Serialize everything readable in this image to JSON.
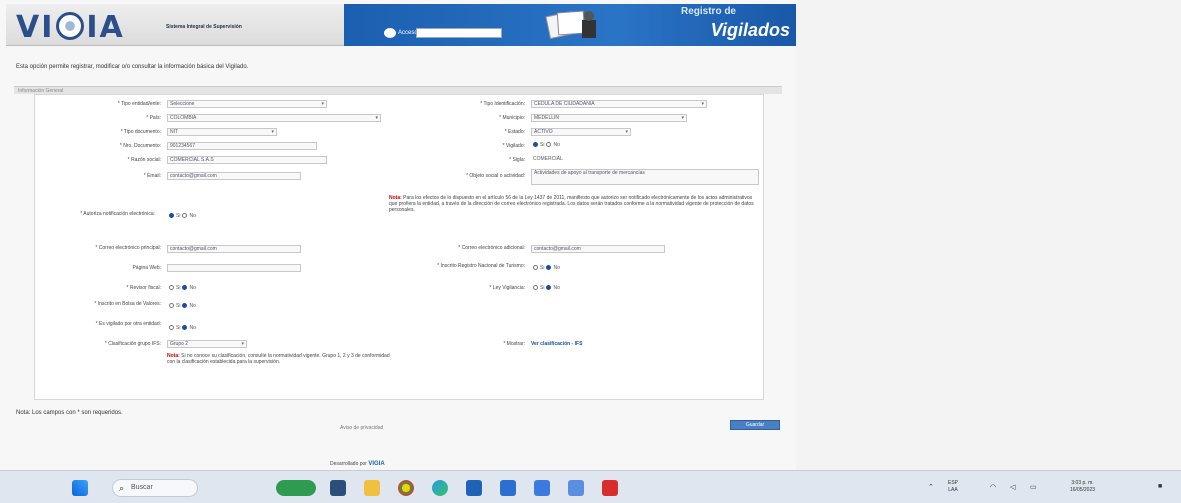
{
  "header": {
    "logo": "VIGIA",
    "logo_subtitle": "Sistema Integral de Supervisión",
    "access_label": "Acceso",
    "title_line1": "Registro de",
    "title_line2": "Vigilados"
  },
  "instruction": "Esta opción permite registrar, modificar o/o consultar la información básica del Vigilado.",
  "section_title": "Información General",
  "form": {
    "fields": [
      {
        "label": "* Tipo entidad/ente:",
        "value": "Seleccione"
      },
      {
        "label": "* Tipo Identificación:",
        "value": "CEDULA DE CIUDADANIA"
      },
      {
        "label": "* País:",
        "value": "COLOMBIA"
      },
      {
        "label": "* Municipio:",
        "value": "MEDELLIN"
      },
      {
        "label": "* Tipo documento:",
        "value": "NIT"
      },
      {
        "label": "* Estado:",
        "value": "ACTIVO"
      },
      {
        "label": "* Nro. Documento:",
        "value": "901234567"
      },
      {
        "label": "* Vigilado:",
        "value": ""
      },
      {
        "label": "* Razón social:",
        "value": "COMERCIAL S.A.S"
      },
      {
        "label": "* Sigla:",
        "value": "COMERCIAL"
      },
      {
        "label": "* Email:",
        "value": "contacto@gmail.com"
      },
      {
        "label": "* Objeto social o actividad:",
        "value": "Actividades de apoyo al transporte de mercancías"
      },
      {
        "label": "* Autoriza notificación electrónica:",
        "value": ""
      },
      {
        "label": "* Correo electrónico principal:",
        "value": "contacto@gmail.com"
      },
      {
        "label": "* Correo electrónico adicional:",
        "value": "contacto@gmail.com"
      },
      {
        "label": "Página Web:",
        "value": ""
      },
      {
        "label": "* Inscrito Registro Nacional de Turismo:",
        "value": ""
      },
      {
        "label": "* Revisor fiscal:",
        "value": ""
      },
      {
        "label": "* Ley Vigilancia:",
        "value": ""
      },
      {
        "label": "* Inscrito en Bolsa de Valores:",
        "value": ""
      },
      {
        "label": "* Es vigilado por otra entidad:",
        "value": ""
      },
      {
        "label": "* Clasificación grupo IFS:",
        "value": "Grupo 2"
      },
      {
        "label": "* Mostrar:",
        "value": ""
      }
    ],
    "radio_si": "Si",
    "radio_no": "No",
    "note_label": "Nota:",
    "note_right": "Para los efectos de lo dispuesto en el artículo 56 de la Ley 1437 de 2011, manifiesto que autorizo ser notificado electrónicamente de los actos administrativos que profiera la entidad, a través de la dirección de correo electrónico registrada. Los datos serán tratados conforme a la normatividad vigente de protección de datos personales.",
    "note_bottom": "Si no conoce su clasificación, consulte la normatividad vigente. Grupo 1, 2 y 3 de conformidad con la clasificación establecida para la supervisión.",
    "link_text": "Ver clasificación - IFS"
  },
  "bottom_note": "Nota: Los campos con * son requeridos.",
  "bottom_center": "Aviso de privacidad",
  "submit_label": "Guardar",
  "footer": {
    "prefix": "Desarrollado por",
    "brand": "VIGIA"
  },
  "taskbar": {
    "search_placeholder": "Buscar",
    "language": "ESP",
    "language_sub": "LAA",
    "time": "3:03 p. m.",
    "date": "16/05/2023"
  }
}
